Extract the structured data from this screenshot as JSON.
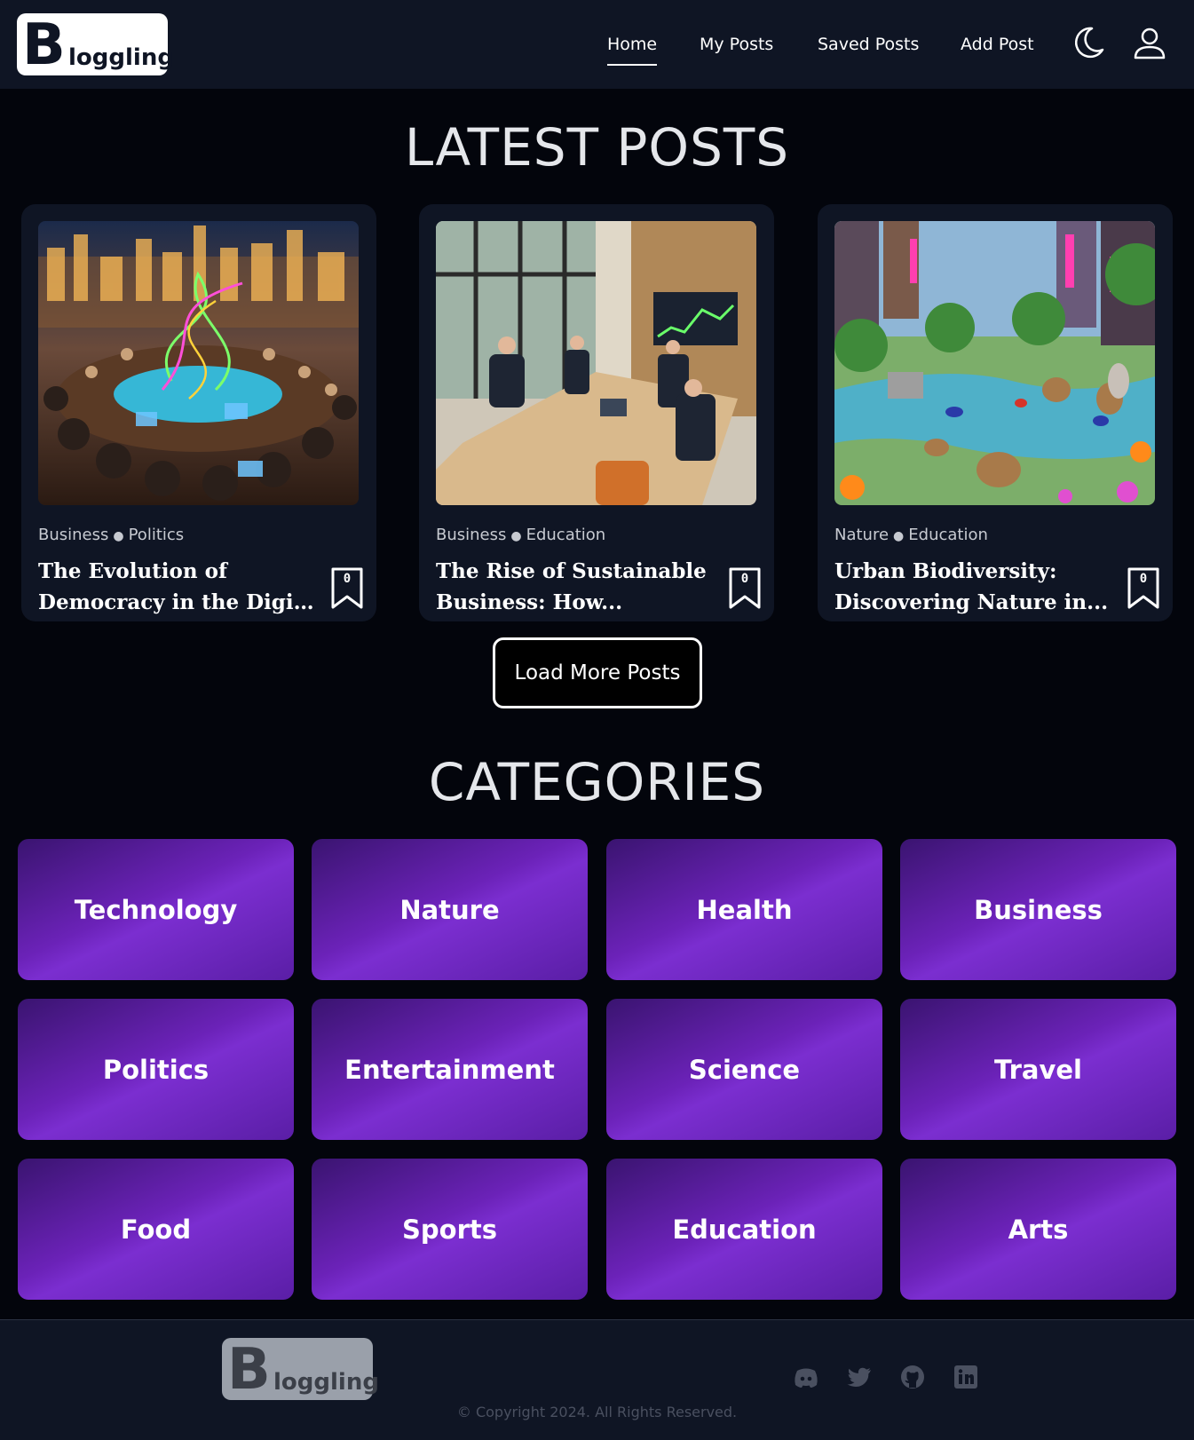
{
  "app": {
    "logo_letter": "B",
    "logo_text": "loggling"
  },
  "nav": {
    "items": [
      {
        "label": "Home",
        "active": true
      },
      {
        "label": "My Posts",
        "active": false
      },
      {
        "label": "Saved Posts",
        "active": false
      },
      {
        "label": "Add Post",
        "active": false
      }
    ],
    "icons": [
      "moon-icon",
      "user-icon"
    ]
  },
  "latest": {
    "title": "LATEST POSTS",
    "posts": [
      {
        "cat1": "Business",
        "cat2": "Politics",
        "title_line1": "The Evolution of",
        "title_line2": "Democracy in the Digit...",
        "bookmarks": "0",
        "image": "roundtable-meeting-city-night"
      },
      {
        "cat1": "Business",
        "cat2": "Education",
        "title_line1": "The Rise of Sustainable",
        "title_line2": "Business: How...",
        "bookmarks": "0",
        "image": "office-meeting-room"
      },
      {
        "cat1": "Nature",
        "cat2": "Education",
        "title_line1": "Urban Biodiversity:",
        "title_line2": "Discovering Nature in...",
        "bookmarks": "0",
        "image": "city-park-animals"
      }
    ],
    "load_more": "Load More Posts"
  },
  "categories": {
    "title": "CATEGORIES",
    "items": [
      "Technology",
      "Nature",
      "Health",
      "Business",
      "Politics",
      "Entertainment",
      "Science",
      "Travel",
      "Food",
      "Sports",
      "Education",
      "Arts"
    ]
  },
  "footer": {
    "social": [
      "discord-icon",
      "twitter-icon",
      "github-icon",
      "linkedin-icon"
    ],
    "copyright": "© Copyright 2024. All Rights Reserved."
  },
  "colors": {
    "background": "#03050c",
    "header": "#0f1524",
    "category_tile": "#6b22b8"
  }
}
